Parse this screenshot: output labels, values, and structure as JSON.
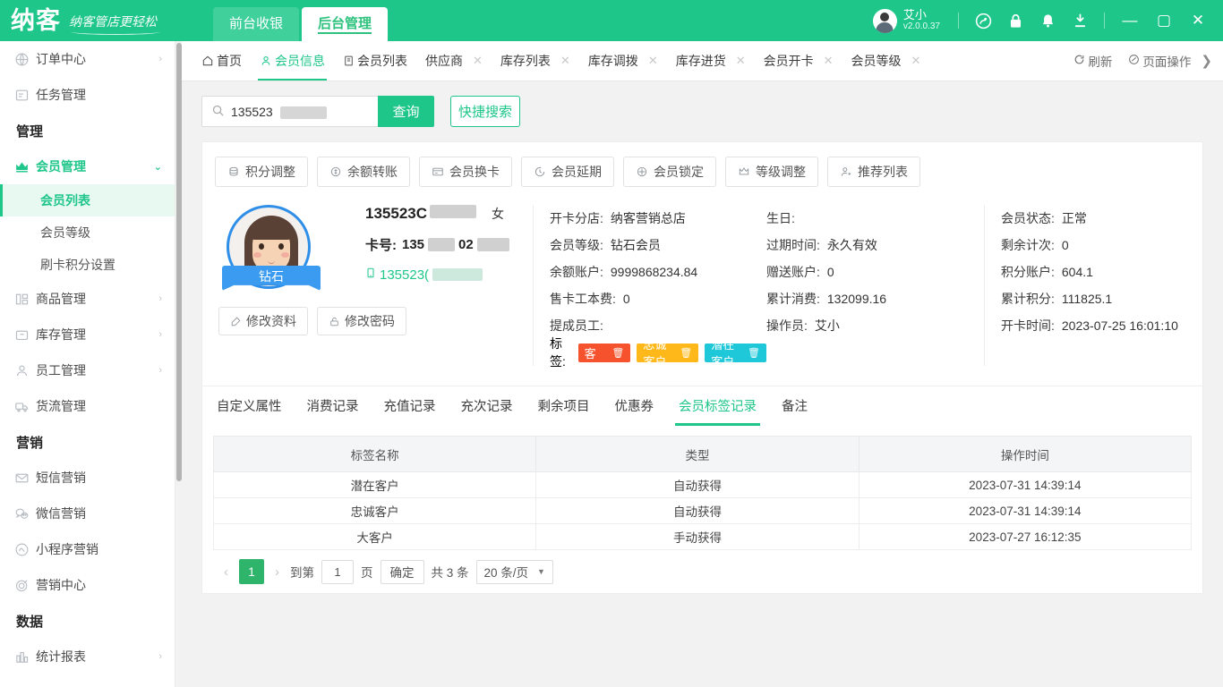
{
  "app": {
    "logo_text": "纳客",
    "slogan": "纳客管店更轻松",
    "mode_tabs": [
      {
        "label": "前台收银",
        "active": false
      },
      {
        "label": "后台管理",
        "active": true
      }
    ],
    "user": {
      "name": "艾小",
      "version": "v2.0.0.37"
    },
    "header_icons": [
      {
        "name": "headset-icon"
      },
      {
        "name": "lock-icon"
      },
      {
        "name": "bell-icon"
      },
      {
        "name": "download-icon"
      }
    ],
    "window_buttons": [
      {
        "name": "minimize-button",
        "glyph": "—"
      },
      {
        "name": "maximize-button",
        "glyph": "▢"
      },
      {
        "name": "close-button",
        "glyph": "✕"
      }
    ],
    "accent_color": "#1ec68a"
  },
  "sidebar": {
    "items": [
      {
        "type": "item",
        "label": "订单中心",
        "icon": "globe-icon",
        "chevron": "›"
      },
      {
        "type": "item",
        "label": "任务管理",
        "icon": "task-icon",
        "chevron": ""
      },
      {
        "type": "group",
        "label": "管理"
      },
      {
        "type": "item",
        "label": "会员管理",
        "icon": "crown-icon",
        "chevron": "⌄",
        "active": true
      },
      {
        "type": "sub",
        "label": "会员列表",
        "active": true
      },
      {
        "type": "sub",
        "label": "会员等级"
      },
      {
        "type": "sub",
        "label": "刷卡积分设置"
      },
      {
        "type": "item",
        "label": "商品管理",
        "icon": "goods-icon",
        "chevron": "›"
      },
      {
        "type": "item",
        "label": "库存管理",
        "icon": "inventory-icon",
        "chevron": "›"
      },
      {
        "type": "item",
        "label": "员工管理",
        "icon": "staff-icon",
        "chevron": "›"
      },
      {
        "type": "item",
        "label": "货流管理",
        "icon": "truck-icon",
        "chevron": ""
      },
      {
        "type": "group",
        "label": "营销"
      },
      {
        "type": "item",
        "label": "短信营销",
        "icon": "envelope-icon",
        "chevron": ""
      },
      {
        "type": "item",
        "label": "微信营销",
        "icon": "wechat-icon",
        "chevron": ""
      },
      {
        "type": "item",
        "label": "小程序营销",
        "icon": "miniprogram-icon",
        "chevron": ""
      },
      {
        "type": "item",
        "label": "营销中心",
        "icon": "target-icon",
        "chevron": ""
      },
      {
        "type": "group",
        "label": "数据"
      },
      {
        "type": "item",
        "label": "统计报表",
        "icon": "barchart-icon",
        "chevron": "›"
      }
    ]
  },
  "tabbar": {
    "tabs": [
      {
        "label": "首页",
        "icon": "home-icon",
        "closable": false,
        "active": false
      },
      {
        "label": "会员信息",
        "icon": "member-icon",
        "closable": false,
        "active": true
      },
      {
        "label": "会员列表",
        "icon": "list-icon",
        "closable": false,
        "active": false
      },
      {
        "label": "供应商",
        "icon": "",
        "closable": true,
        "active": false
      },
      {
        "label": "库存列表",
        "icon": "",
        "closable": true,
        "active": false
      },
      {
        "label": "库存调拨",
        "icon": "",
        "closable": true,
        "active": false
      },
      {
        "label": "库存进货",
        "icon": "",
        "closable": true,
        "active": false
      },
      {
        "label": "会员开卡",
        "icon": "",
        "closable": true,
        "active": false
      },
      {
        "label": "会员等级",
        "icon": "",
        "closable": true,
        "active": false
      }
    ],
    "actions": [
      {
        "label": "刷新",
        "icon": "refresh-icon"
      },
      {
        "label": "页面操作",
        "icon": "page-ops-icon"
      }
    ],
    "scroll_arrow": "❯",
    "close_glyph": "✕"
  },
  "search": {
    "value": "135523",
    "query_label": "查询",
    "quick_label": "快捷搜索"
  },
  "operations": [
    {
      "label": "积分调整",
      "icon": "points-icon"
    },
    {
      "label": "余额转账",
      "icon": "transfer-icon"
    },
    {
      "label": "会员换卡",
      "icon": "card-swap-icon"
    },
    {
      "label": "会员延期",
      "icon": "clock-icon"
    },
    {
      "label": "会员锁定",
      "icon": "lock-circle-icon"
    },
    {
      "label": "等级调整",
      "icon": "crown-icon"
    },
    {
      "label": "推荐列表",
      "icon": "person-add-icon"
    }
  ],
  "member": {
    "name_prefix": "135523C",
    "gender": "女",
    "level_ribbon": "钻石",
    "card_label": "卡号:",
    "card_prefix": "135",
    "card_mid": "02",
    "phone_prefix": "135523(",
    "edit_profile_label": "修改资料",
    "edit_password_label": "修改密码",
    "fields_col1": [
      {
        "key": "开卡分店:",
        "value": "纳客营销总店"
      },
      {
        "key": "会员等级:",
        "value": "钻石会员"
      },
      {
        "key": "余额账户:",
        "value": "9999868234.84"
      },
      {
        "key": "售卡工本费:",
        "value": "0"
      },
      {
        "key": "提成员工:",
        "value": ""
      }
    ],
    "fields_col2": [
      {
        "key": "生日:",
        "value": ""
      },
      {
        "key": "过期时间:",
        "value": "永久有效"
      },
      {
        "key": "赠送账户:",
        "value": "0"
      },
      {
        "key": "累计消费:",
        "value": "132099.16"
      },
      {
        "key": "操作员:",
        "value": "艾小"
      }
    ],
    "fields_col3": [
      {
        "key": "会员状态:",
        "value": "正常"
      },
      {
        "key": "剩余计次:",
        "value": "0"
      },
      {
        "key": "积分账户:",
        "value": "604.1"
      },
      {
        "key": "累计积分:",
        "value": "111825.1"
      },
      {
        "key": "开卡时间:",
        "value": "2023-07-25 16:01:10"
      }
    ],
    "tags_label": "标签:",
    "tags": [
      {
        "label": "大客户",
        "color": "#f5522d"
      },
      {
        "label": "忠诚客户",
        "color": "#ffb819"
      },
      {
        "label": "潜在客户",
        "color": "#1fc8d8"
      }
    ],
    "tag_delete_glyph": "🗑"
  },
  "subtabs": [
    {
      "label": "自定义属性",
      "active": false
    },
    {
      "label": "消费记录",
      "active": false
    },
    {
      "label": "充值记录",
      "active": false
    },
    {
      "label": "充次记录",
      "active": false
    },
    {
      "label": "剩余项目",
      "active": false
    },
    {
      "label": "优惠券",
      "active": false
    },
    {
      "label": "会员标签记录",
      "active": true
    },
    {
      "label": "备注",
      "active": false
    }
  ],
  "table": {
    "headers": [
      "标签名称",
      "类型",
      "操作时间"
    ],
    "rows": [
      [
        "潜在客户",
        "自动获得",
        "2023-07-31 14:39:14"
      ],
      [
        "忠诚客户",
        "自动获得",
        "2023-07-31 14:39:14"
      ],
      [
        "大客户",
        "手动获得",
        "2023-07-27 16:12:35"
      ]
    ]
  },
  "pager": {
    "prev_glyph": "‹",
    "next_glyph": "›",
    "current_page": "1",
    "goto_label": "到第",
    "goto_value": "1",
    "page_unit": "页",
    "confirm_label": "确定",
    "total_label": "共 3 条",
    "page_size": "20 条/页",
    "caret": "▼"
  }
}
